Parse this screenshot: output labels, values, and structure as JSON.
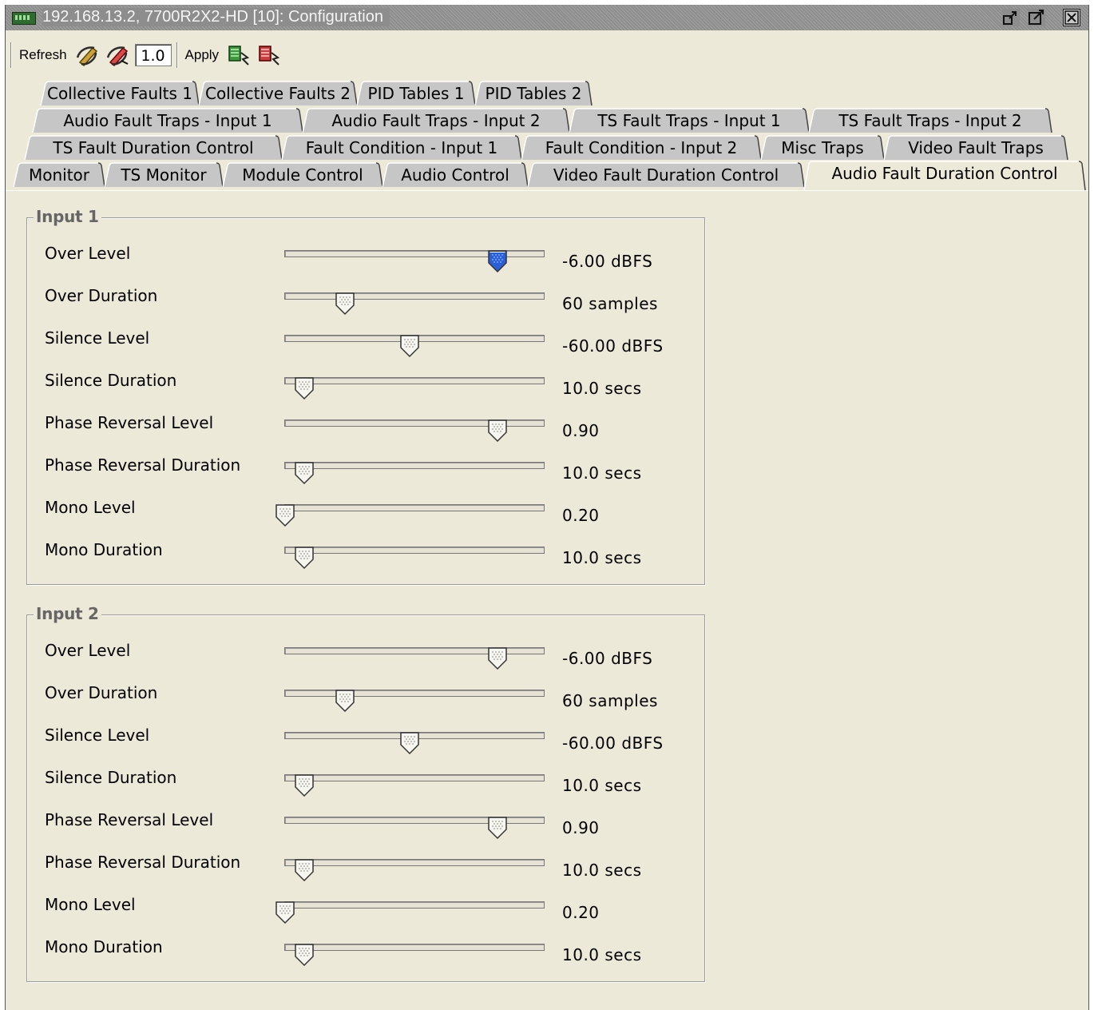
{
  "window": {
    "title": "192.168.13.2, 7700R2X2-HD  [10]: Configuration",
    "controls": [
      "restore-icon",
      "maximize-icon",
      "close-icon"
    ]
  },
  "toolbar": {
    "refresh_label": "Refresh",
    "version_value": "1.0",
    "apply_label": "Apply"
  },
  "tabs": {
    "row1": [
      "Collective Faults 1",
      "Collective Faults 2",
      "PID Tables 1",
      "PID Tables 2"
    ],
    "row2": [
      "Audio Fault Traps - Input 1",
      "Audio Fault Traps - Input 2",
      "TS Fault Traps - Input 1",
      "TS Fault Traps - Input 2"
    ],
    "row3": [
      "TS Fault Duration Control",
      "Fault Condition - Input 1",
      "Fault Condition - Input 2",
      "Misc Traps",
      "Video Fault Traps"
    ],
    "row4": [
      "Monitor",
      "TS Monitor",
      "Module Control",
      "Audio Control",
      "Video Fault Duration Control",
      "Audio Fault Duration Control"
    ],
    "active": "Audio Fault Duration Control"
  },
  "groups": [
    {
      "title": "Input 1",
      "rows": [
        {
          "label": "Over Level",
          "value": "-6.00 dBFS",
          "position": 0.82,
          "focused": true
        },
        {
          "label": "Over Duration",
          "value": "60 samples",
          "position": 0.23
        },
        {
          "label": "Silence Level",
          "value": "-60.00 dBFS",
          "position": 0.48
        },
        {
          "label": "Silence Duration",
          "value": "10.0 secs",
          "position": 0.075
        },
        {
          "label": "Phase Reversal Level",
          "value": "0.90",
          "position": 0.82
        },
        {
          "label": "Phase Reversal Duration",
          "value": "10.0 secs",
          "position": 0.075
        },
        {
          "label": "Mono Level",
          "value": "0.20",
          "position": 0.0
        },
        {
          "label": "Mono Duration",
          "value": "10.0 secs",
          "position": 0.075
        }
      ]
    },
    {
      "title": "Input 2",
      "rows": [
        {
          "label": "Over Level",
          "value": "-6.00 dBFS",
          "position": 0.82
        },
        {
          "label": "Over Duration",
          "value": "60 samples",
          "position": 0.23
        },
        {
          "label": "Silence Level",
          "value": "-60.00 dBFS",
          "position": 0.48
        },
        {
          "label": "Silence Duration",
          "value": "10.0 secs",
          "position": 0.075
        },
        {
          "label": "Phase Reversal Level",
          "value": "0.90",
          "position": 0.82
        },
        {
          "label": "Phase Reversal Duration",
          "value": "10.0 secs",
          "position": 0.075
        },
        {
          "label": "Mono Level",
          "value": "0.20",
          "position": 0.0
        },
        {
          "label": "Mono Duration",
          "value": "10.0 secs",
          "position": 0.075
        }
      ]
    }
  ],
  "colors": {
    "background": "#ece9d8",
    "inactive_tab": "#c6c6c6",
    "titlebar": "#8d8d8d",
    "focused_thumb": "#2a5fd8"
  }
}
